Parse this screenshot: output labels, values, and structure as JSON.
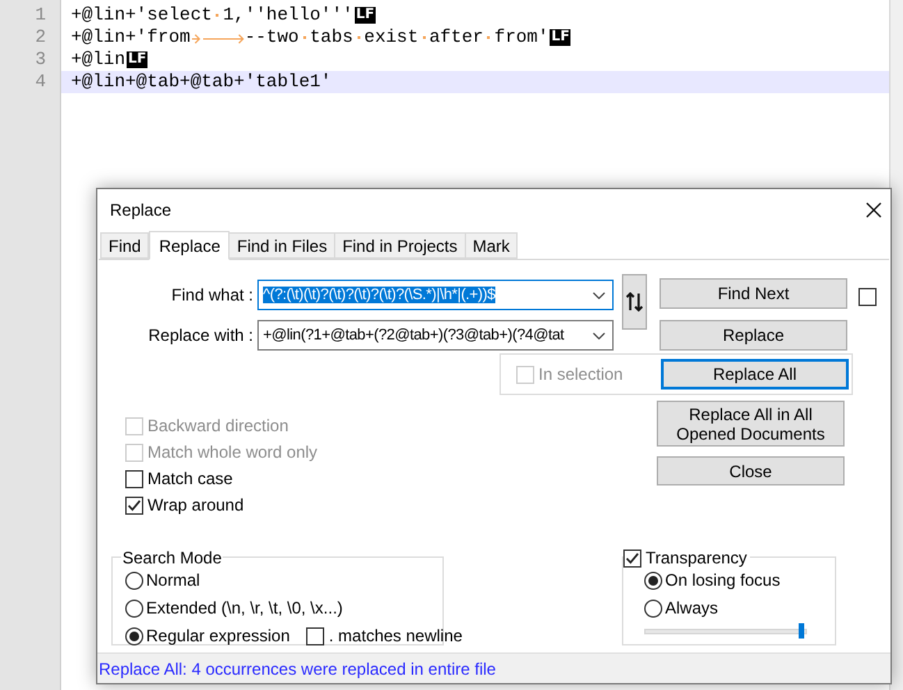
{
  "editor": {
    "lines": [
      {
        "number": "1",
        "current": false,
        "eol": "LF",
        "segments": [
          {
            "kind": "text",
            "text": "+@lin+'select"
          },
          {
            "kind": "space"
          },
          {
            "kind": "text",
            "text": "1,''hello'''"
          }
        ]
      },
      {
        "number": "2",
        "current": false,
        "eol": "LF",
        "segments": [
          {
            "kind": "text",
            "text": "+@lin+'from"
          },
          {
            "kind": "tab"
          },
          {
            "kind": "tab"
          },
          {
            "kind": "text",
            "text": "--two"
          },
          {
            "kind": "space"
          },
          {
            "kind": "text",
            "text": "tabs"
          },
          {
            "kind": "space"
          },
          {
            "kind": "text",
            "text": "exist"
          },
          {
            "kind": "space"
          },
          {
            "kind": "text",
            "text": "after"
          },
          {
            "kind": "space"
          },
          {
            "kind": "text",
            "text": "from'"
          }
        ]
      },
      {
        "number": "3",
        "current": false,
        "eol": "LF",
        "segments": [
          {
            "kind": "text",
            "text": "+@lin"
          }
        ]
      },
      {
        "number": "4",
        "current": true,
        "segments": [
          {
            "kind": "text",
            "text": "+@lin+@tab+@tab+'table1'"
          }
        ]
      }
    ]
  },
  "dialog": {
    "title": "Replace",
    "tabs": [
      {
        "label": "Find",
        "selected": false
      },
      {
        "label": "Replace",
        "selected": true
      },
      {
        "label": "Find in Files",
        "selected": false
      },
      {
        "label": "Find in Projects",
        "selected": false
      },
      {
        "label": "Mark",
        "selected": false
      }
    ],
    "find_what": {
      "label": "Find what :",
      "value": "^(?:(\\t)(\\t)?(\\t)?(\\t)?(\\t)?(\\S.*)|\\h*|(.+))$",
      "value_selected": true
    },
    "replace_with": {
      "label": "Replace with :",
      "value": "+@lin(?1+@tab+(?2@tab+)(?3@tab+)(?4@tat",
      "value_selected": false
    },
    "find_buttons": [
      {
        "label": "Find Next",
        "focused": false
      },
      {
        "label": "Replace",
        "focused": false
      }
    ],
    "side_checkbox": {
      "checked": false
    },
    "in_selection": {
      "label": "In selection",
      "checked": false,
      "disabled": true
    },
    "replace_all": {
      "label": "Replace All",
      "focused": true
    },
    "more_buttons": [
      {
        "label": "Replace All in All Opened Documents",
        "focused": false
      },
      {
        "label": "Close",
        "focused": false
      }
    ],
    "options": [
      {
        "label": "Backward direction",
        "checked": false,
        "disabled": true
      },
      {
        "label": "Match whole word only",
        "checked": false,
        "disabled": true
      },
      {
        "label": "Match case",
        "checked": false,
        "disabled": false
      },
      {
        "label": "Wrap around",
        "checked": true,
        "disabled": false
      }
    ],
    "search_mode": {
      "title": "Search Mode",
      "options": [
        {
          "label": "Normal",
          "selected": false
        },
        {
          "label": "Extended (\\n, \\r, \\t, \\0, \\x...)",
          "selected": false
        },
        {
          "label": "Regular expression",
          "selected": true
        }
      ],
      "newline": {
        "label": ". matches newline",
        "checked": false
      }
    },
    "transparency": {
      "label": "Transparency",
      "checked": true,
      "options": [
        {
          "label": "On losing focus",
          "selected": true
        },
        {
          "label": "Always",
          "selected": false
        }
      ],
      "level": 0.97
    },
    "status": "Replace All: 4 occurrences were replaced in entire file"
  }
}
